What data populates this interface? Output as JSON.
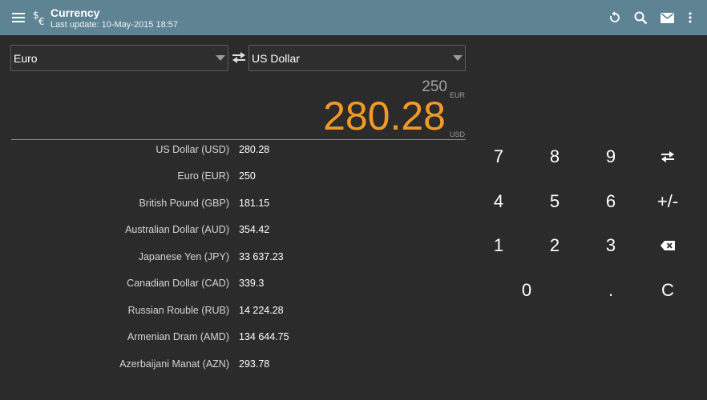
{
  "toolbar": {
    "title": "Currency",
    "subtitle": "Last update: 10-May-2015 18:57",
    "icons": [
      "menu-icon",
      "currency-exchange-icon",
      "refresh-icon",
      "search-icon",
      "mail-icon",
      "more-vert-icon"
    ]
  },
  "from_select": {
    "value": "Euro"
  },
  "to_select": {
    "value": "US Dollar"
  },
  "conversion": {
    "input_amount": "250",
    "input_code": "EUR",
    "output_amount": "280.28",
    "output_code": "USD"
  },
  "rates": [
    {
      "name": "US Dollar  (USD)",
      "amount": "280.28"
    },
    {
      "name": "Euro  (EUR)",
      "amount": "250"
    },
    {
      "name": "British Pound  (GBP)",
      "amount": "181.15"
    },
    {
      "name": "Australian Dollar  (AUD)",
      "amount": "354.42"
    },
    {
      "name": "Japanese Yen  (JPY)",
      "amount": "33 637.23"
    },
    {
      "name": "Canadian Dollar  (CAD)",
      "amount": "339.3"
    },
    {
      "name": "Russian Rouble  (RUB)",
      "amount": "14 224.28"
    },
    {
      "name": "Armenian Dram  (AMD)",
      "amount": "134 644.75"
    },
    {
      "name": "Azerbaijani Manat  (AZN)",
      "amount": "293.78"
    }
  ],
  "keypad": {
    "k7": "7",
    "k8": "8",
    "k9": "9",
    "k4": "4",
    "k5": "5",
    "k6": "6",
    "plusminus": "+/-",
    "k1": "1",
    "k2": "2",
    "k3": "3",
    "k0": "0",
    "dot": ".",
    "clear": "C"
  },
  "colors": {
    "toolbar": "#5e8393",
    "background": "#2b2b2b",
    "accent": "#f39a26"
  }
}
